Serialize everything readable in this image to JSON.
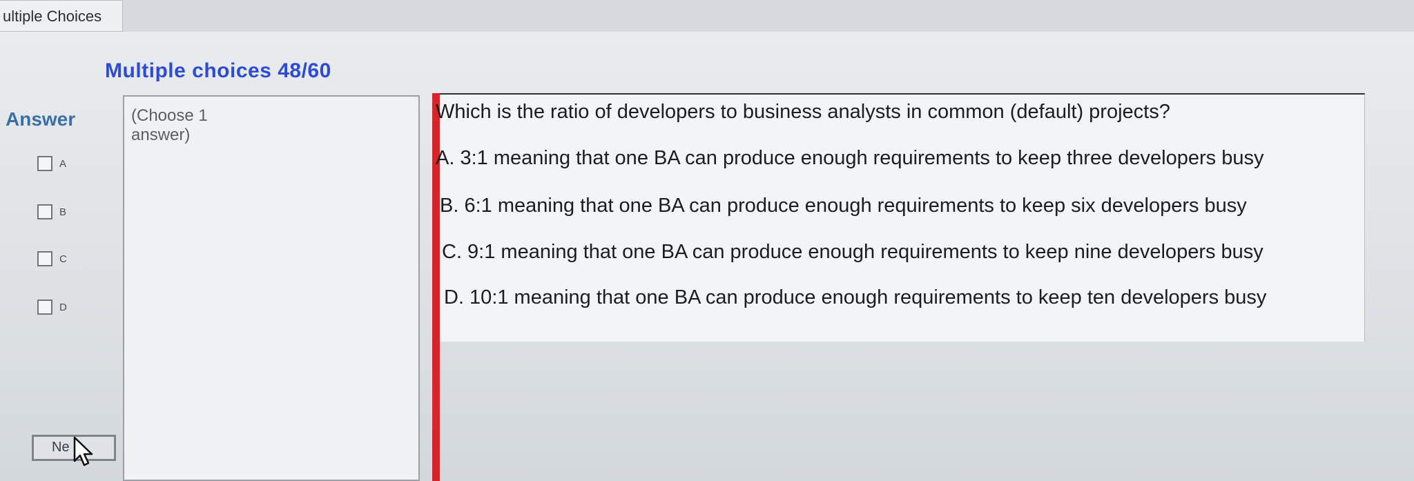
{
  "window": {
    "tab_title": "ultiple Choices"
  },
  "header": {
    "title": "Multiple choices 48/60"
  },
  "answer_panel": {
    "label": "Answer",
    "options": [
      {
        "letter": "A"
      },
      {
        "letter": "B"
      },
      {
        "letter": "C"
      },
      {
        "letter": "D"
      }
    ],
    "next_label": "Ne"
  },
  "instructions": {
    "line1": "(Choose 1",
    "line2": "answer)"
  },
  "question": {
    "text": "Which is the ratio of developers to business analysts in common (default) projects?",
    "choices": [
      "A.  3:1 meaning that one BA can produce enough requirements to keep three developers busy",
      "B.  6:1 meaning that one BA can produce enough requirements to keep six developers busy",
      "C.  9:1 meaning that one BA can produce enough requirements to keep nine developers busy",
      "D.  10:1 meaning that one BA can produce enough requirements to keep ten developers busy"
    ]
  },
  "colors": {
    "heading": "#2d4bd6",
    "answer_label": "#3a6fa8",
    "divider": "#d6242a"
  },
  "icons": {
    "cursor": "mouse-pointer-icon"
  }
}
